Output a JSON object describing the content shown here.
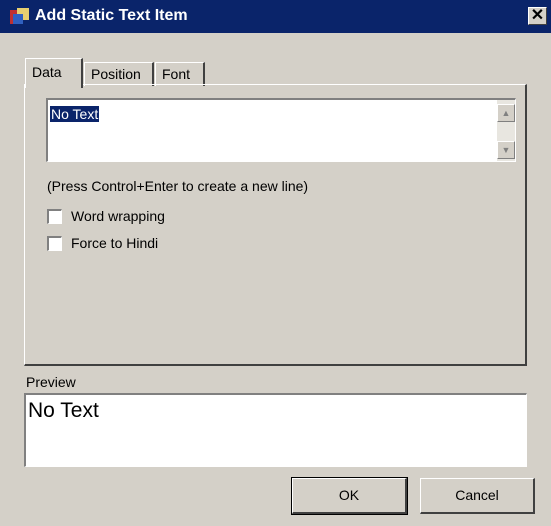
{
  "window": {
    "title": "Add Static Text Item",
    "close_glyph": "✕",
    "icon": "app-icon"
  },
  "tabs": [
    {
      "label": "Data",
      "active": true
    },
    {
      "label": "Position",
      "active": false
    },
    {
      "label": "Font",
      "active": false
    }
  ],
  "data_tab": {
    "text_value": "No Text",
    "hint": "(Press Control+Enter to create a new line)",
    "checkboxes": [
      {
        "label": "Word wrapping",
        "checked": false
      },
      {
        "label": "Force to Hindi",
        "checked": false
      }
    ]
  },
  "preview": {
    "label": "Preview",
    "text": "No Text"
  },
  "buttons": {
    "ok": "OK",
    "cancel": "Cancel"
  },
  "colors": {
    "titlebar": "#0a246a",
    "face": "#d4d0c8",
    "selection": "#0a246a"
  }
}
